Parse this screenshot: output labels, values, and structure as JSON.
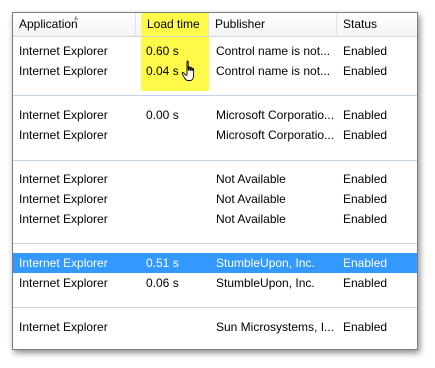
{
  "columns": {
    "application": "Application",
    "load_time": "Load time",
    "publisher": "Publisher",
    "status": "Status"
  },
  "groups": [
    {
      "rows": [
        {
          "application": "Internet Explorer",
          "load_time": "0.60 s",
          "publisher": "Control name is not...",
          "status": "Enabled"
        },
        {
          "application": "Internet Explorer",
          "load_time": "0.04 s",
          "publisher": "Control name is not...",
          "status": "Enabled"
        }
      ]
    },
    {
      "rows": [
        {
          "application": "Internet Explorer",
          "load_time": "0.00 s",
          "publisher": "Microsoft Corporatio...",
          "status": "Enabled"
        },
        {
          "application": "Internet Explorer",
          "load_time": "",
          "publisher": "Microsoft Corporatio...",
          "status": "Enabled"
        }
      ]
    },
    {
      "rows": [
        {
          "application": "Internet Explorer",
          "load_time": "",
          "publisher": "Not Available",
          "status": "Enabled"
        },
        {
          "application": "Internet Explorer",
          "load_time": "",
          "publisher": "Not Available",
          "status": "Enabled"
        },
        {
          "application": "Internet Explorer",
          "load_time": "",
          "publisher": "Not Available",
          "status": "Enabled"
        }
      ]
    },
    {
      "rows": [
        {
          "application": "Internet Explorer",
          "load_time": "0.51 s",
          "publisher": "StumbleUpon, Inc.",
          "status": "Enabled",
          "selected": true
        },
        {
          "application": "Internet Explorer",
          "load_time": "0.06 s",
          "publisher": "StumbleUpon, Inc.",
          "status": "Enabled"
        }
      ]
    },
    {
      "rows": [
        {
          "application": "Internet Explorer",
          "load_time": "",
          "publisher": "Sun Microsystems, I...",
          "status": "Enabled"
        }
      ]
    }
  ],
  "colors": {
    "highlight": "#fff94a",
    "selection": "#3399ff",
    "group_separator": "#c4d3e4"
  },
  "icons": {
    "sort": "sort-up-icon",
    "cursor": "hand-pointer-icon"
  }
}
